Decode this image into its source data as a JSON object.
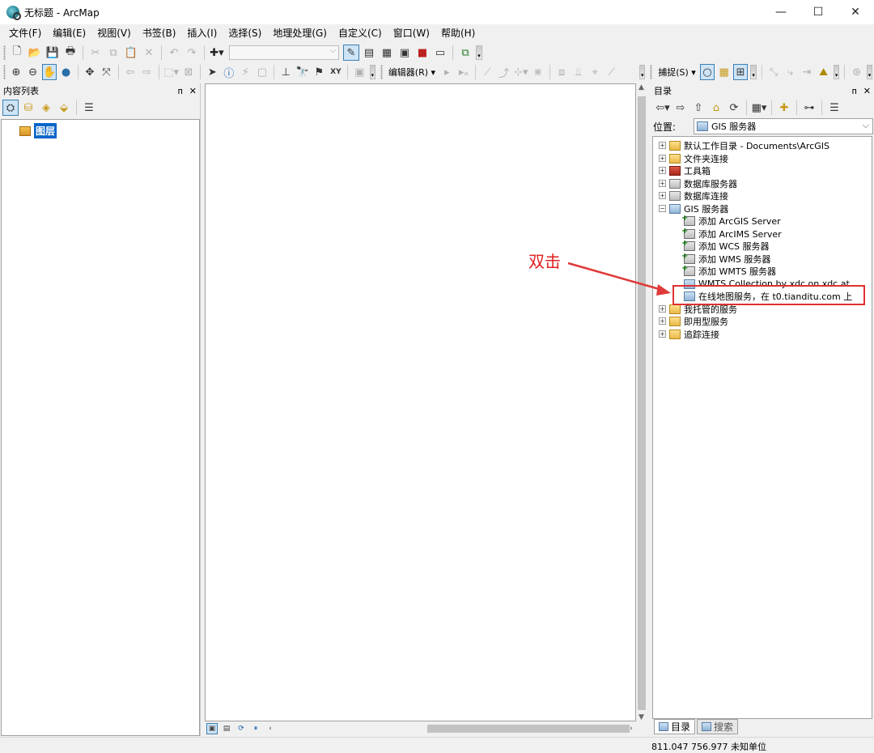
{
  "window": {
    "title": "无标题 - ArcMap",
    "controls": [
      "—",
      "☐",
      "✕"
    ]
  },
  "menu": [
    "文件(F)",
    "编辑(E)",
    "视图(V)",
    "书签(B)",
    "插入(I)",
    "选择(S)",
    "地理处理(G)",
    "自定义(C)",
    "窗口(W)",
    "帮助(H)"
  ],
  "toolbar2": {
    "editor_label": "编辑器(R) ▾",
    "snapping_label": "捕捉(S) ▾"
  },
  "toc": {
    "title": "内容列表",
    "pin": "ᴨ",
    "close": "✕",
    "root_layer": "图层"
  },
  "catalog": {
    "title": "目录",
    "pin": "ᴨ",
    "close": "✕",
    "location_label": "位置:",
    "location_value": "GIS 服务器",
    "tree": [
      {
        "label": "默认工作目录 - Documents\\ArcGIS",
        "expander": "+",
        "icon": "folder-home-icon"
      },
      {
        "label": "文件夹连接",
        "expander": "+",
        "icon": "folder-connection-icon"
      },
      {
        "label": "工具箱",
        "expander": "+",
        "icon": "toolbox-icon"
      },
      {
        "label": "数据库服务器",
        "expander": "+",
        "icon": "database-server-icon"
      },
      {
        "label": "数据库连接",
        "expander": "+",
        "icon": "database-connection-icon"
      },
      {
        "label": "GIS 服务器",
        "expander": "−",
        "icon": "gis-server-icon"
      },
      {
        "label": "添加 ArcGIS Server",
        "icon": "add-server-icon"
      },
      {
        "label": "添加 ArcIMS Server",
        "icon": "add-server-icon"
      },
      {
        "label": "添加 WCS 服务器",
        "icon": "add-server-icon"
      },
      {
        "label": "添加 WMS 服务器",
        "icon": "add-server-icon"
      },
      {
        "label": "添加 WMTS 服务器",
        "icon": "add-server-icon"
      },
      {
        "label": "WMTS Collection by xdc on xdc.at",
        "icon": "wmts-server-icon"
      },
      {
        "label": "在线地图服务，在 t0.tianditu.com 上",
        "icon": "wmts-server-icon"
      },
      {
        "label": "我托管的服务",
        "expander": "+",
        "icon": "hosted-services-icon"
      },
      {
        "label": "即用型服务",
        "expander": "+",
        "icon": "ready-services-icon"
      },
      {
        "label": "追踪连接",
        "expander": "+",
        "icon": "tracking-connection-icon"
      }
    ],
    "tabs": [
      "目录",
      "搜索"
    ]
  },
  "status": {
    "coordinates": "811.047  756.977 未知单位"
  },
  "annotation": {
    "text": "双击",
    "color": "#e02020"
  }
}
